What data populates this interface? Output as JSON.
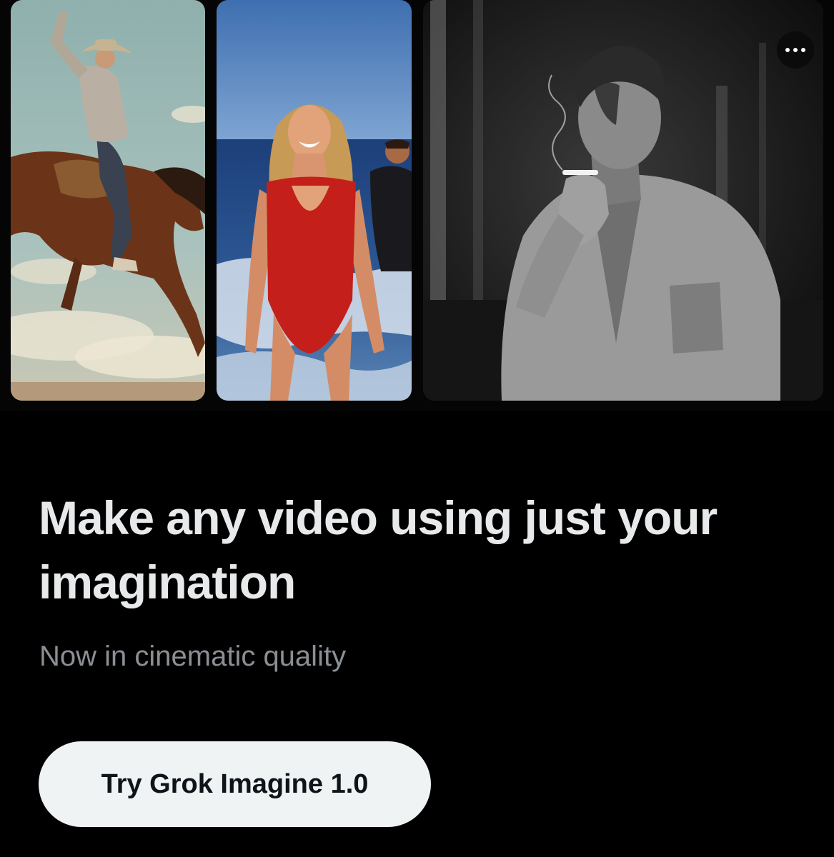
{
  "promo": {
    "headline": "Make any video using just your imagination",
    "subheadline": "Now in cinematic quality",
    "cta_label": "Try Grok Imagine 1.0"
  },
  "menu": {
    "icon": "more-horizontal-icon"
  },
  "gallery": {
    "items": [
      {
        "subject": "cowboy-on-bucking-horse",
        "style": "vintage-color"
      },
      {
        "subject": "woman-in-red-swimsuit-at-beach",
        "style": "retro-color"
      },
      {
        "subject": "man-smoking-cigarette",
        "style": "black-and-white"
      }
    ]
  },
  "colors": {
    "background": "#000000",
    "headline": "#e7e9ea",
    "subheadline": "#8b8f94",
    "button_bg": "#eff3f4",
    "button_text": "#0f1419"
  }
}
